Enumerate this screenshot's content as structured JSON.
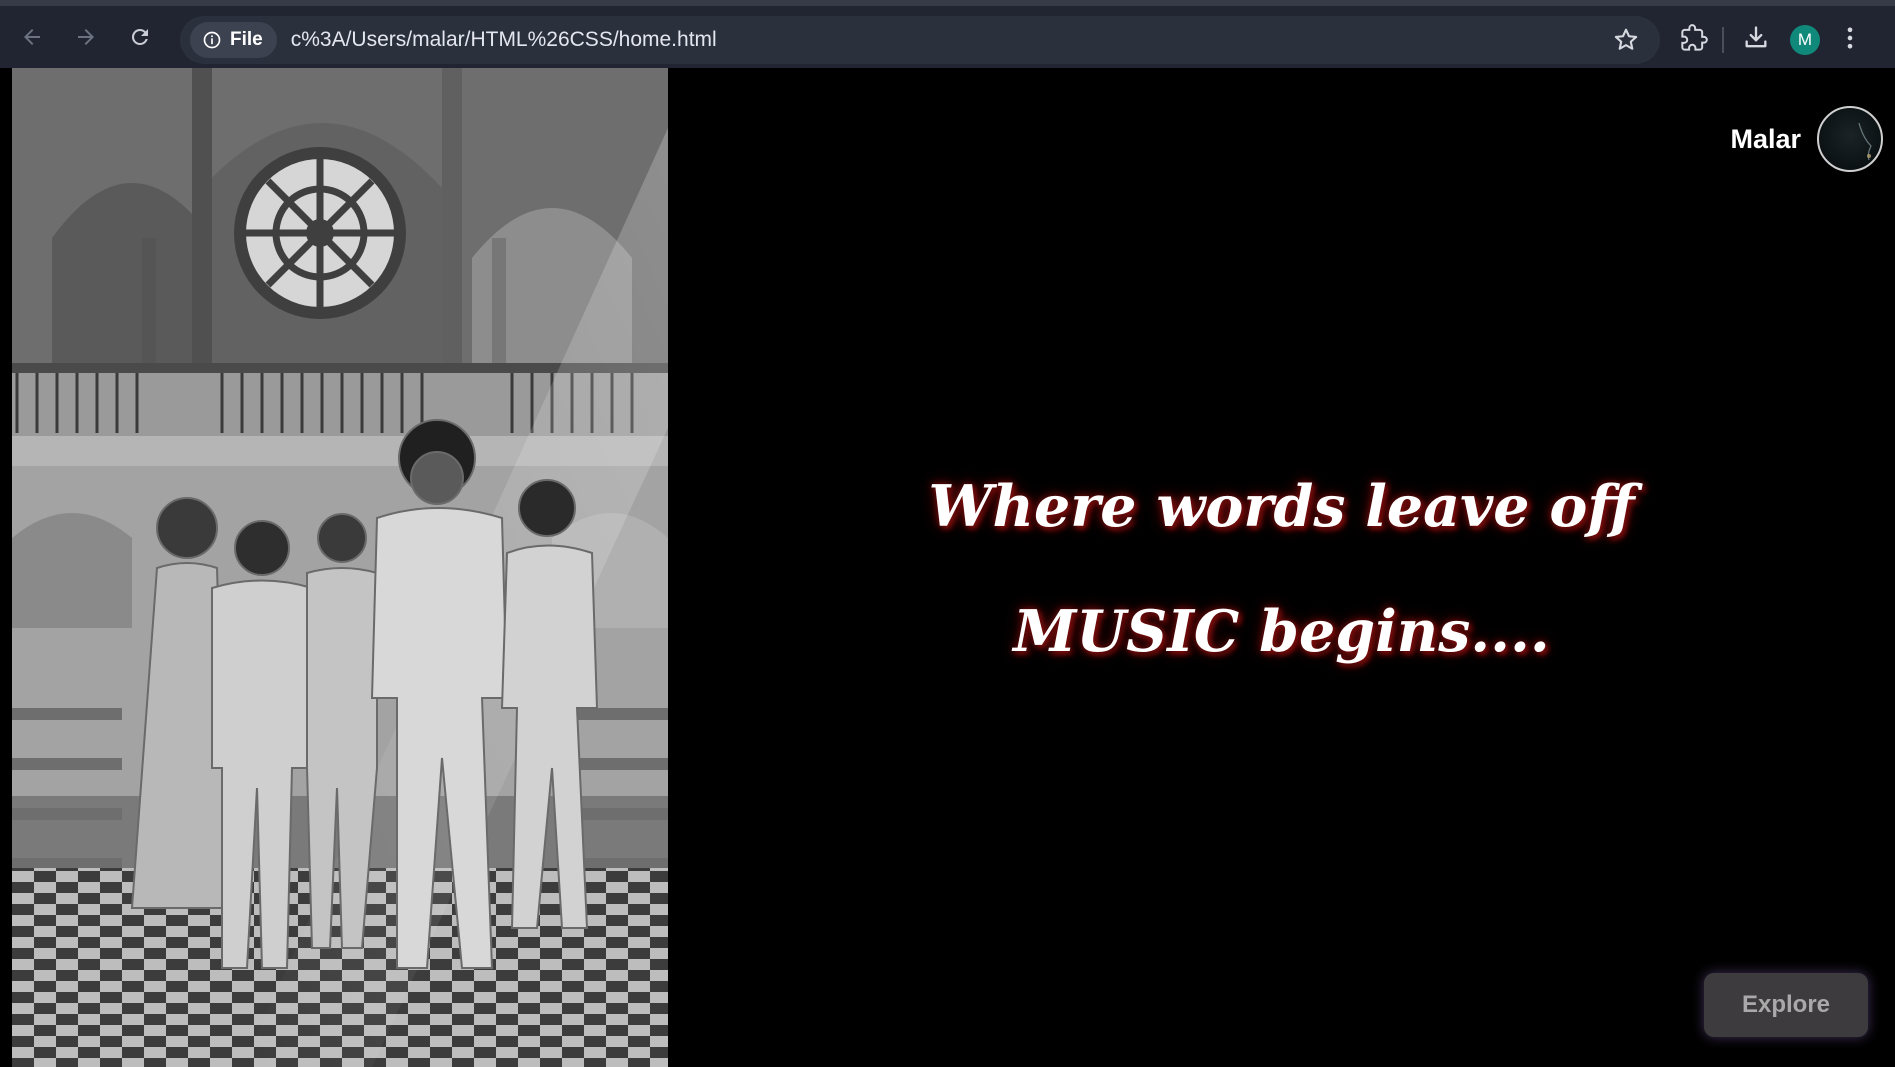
{
  "browser": {
    "file_chip_label": "File",
    "url": "c%3A/Users/malar/HTML%26CSS/home.html",
    "profile_initial": "M"
  },
  "page": {
    "user_name": "Malar",
    "tagline_line1": "Where words leave off",
    "tagline_line2": "MUSIC begins....",
    "explore_label": "Explore"
  },
  "colors": {
    "chrome_bg": "#202531",
    "omnibox_bg": "#2b303d",
    "page_bg": "#000000",
    "profile_bg": "#10897b",
    "glow": "#7a0d0d",
    "button_bg": "#3d3b3d"
  }
}
